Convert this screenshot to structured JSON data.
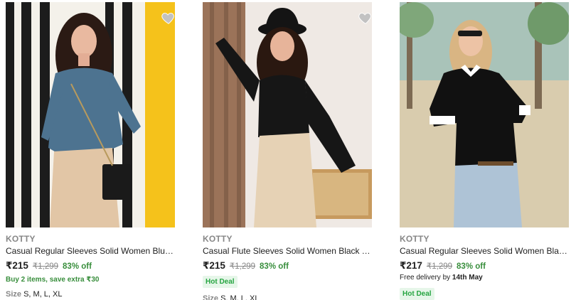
{
  "products": [
    {
      "brand": "KOTTY",
      "title": "Casual Regular Sleeves Solid Women Blue Top",
      "price": "₹215",
      "mrp": "₹1,299",
      "discount": "83% off",
      "offer": "Buy 2 items, save extra ₹30",
      "size_label": "Size",
      "sizes": "S, M, L, XL",
      "wishlist_icon": "heart-icon"
    },
    {
      "brand": "KOTTY",
      "title": "Casual Flute Sleeves Solid Women Black Top",
      "price": "₹215",
      "mrp": "₹1,299",
      "discount": "83% off",
      "badge": "Hot Deal",
      "size_label": "Size",
      "sizes": "S, M, L, XL",
      "wishlist_icon": "heart-icon"
    },
    {
      "brand": "KOTTY",
      "title": "Casual Regular Sleeves Solid Women Black, ...",
      "price": "₹217",
      "mrp": "₹1,299",
      "discount": "83% off",
      "delivery_prefix": "Free delivery by",
      "delivery_date": "14th May",
      "badge": "Hot Deal",
      "wishlist_icon": "heart-icon"
    }
  ],
  "colors": {
    "discount_green": "#388e3c",
    "badge_bg": "#e6f6e9",
    "badge_text": "#26a541",
    "muted": "#878787"
  }
}
